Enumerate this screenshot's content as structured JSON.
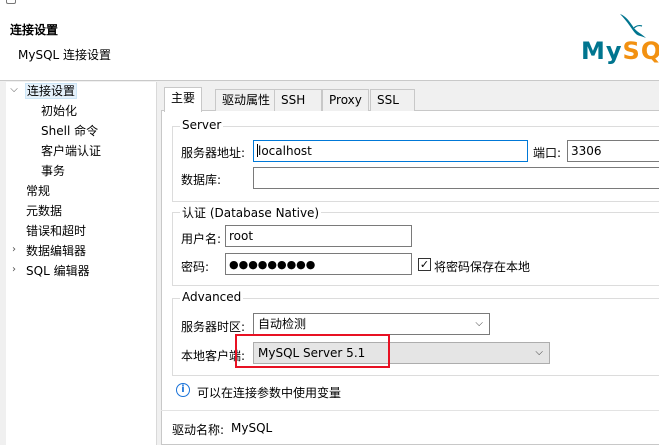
{
  "header": {
    "title": "连接设置",
    "subtitle": "MySQL 连接设置",
    "logo_my": "My",
    "logo_sql": "SQL"
  },
  "tree": {
    "items": [
      {
        "label": "连接设置",
        "expanded": true,
        "selected": true
      },
      {
        "label": "初始化"
      },
      {
        "label": "Shell 命令"
      },
      {
        "label": "客户端认证"
      },
      {
        "label": "事务"
      },
      {
        "label": "常规"
      },
      {
        "label": "元数据"
      },
      {
        "label": "错误和超时"
      },
      {
        "label": "数据编辑器",
        "collapsed": true
      },
      {
        "label": "SQL 编辑器",
        "collapsed": true
      }
    ]
  },
  "tabs": [
    "主要",
    "驱动属性",
    "SSH",
    "Proxy",
    "SSL"
  ],
  "server": {
    "group_title": "Server",
    "host_label": "服务器地址:",
    "host_value": "localhost",
    "port_label": "端口:",
    "port_value": "3306",
    "database_label": "数据库:",
    "database_value": ""
  },
  "auth": {
    "group_title": "认证 (Database Native)",
    "username_label": "用户名:",
    "username_value": "root",
    "password_label": "密码:",
    "password_value": "●●●●●●●●●",
    "save_password_label": "将密码保存在本地",
    "save_password_checked": true
  },
  "advanced": {
    "group_title": "Advanced",
    "timezone_label": "服务器时区:",
    "timezone_value": "自动检测",
    "local_client_label": "本地客户端:",
    "local_client_value": "MySQL Server 5.1"
  },
  "info_text": "可以在连接参数中使用变量",
  "driver": {
    "label": "驱动名称:",
    "value": "MySQL"
  },
  "colors": {
    "accent": "#0078d7",
    "highlight": "#e81123",
    "mysql_blue": "#00758f",
    "mysql_orange": "#f29111"
  }
}
